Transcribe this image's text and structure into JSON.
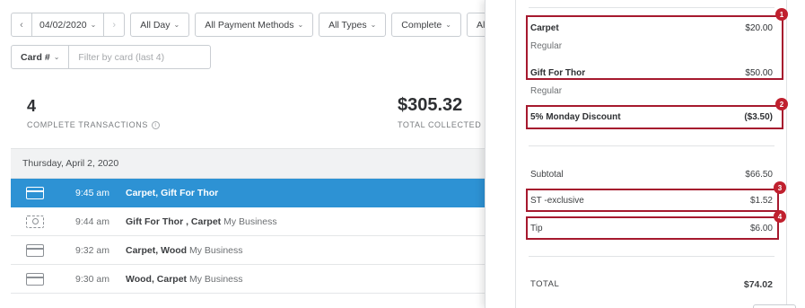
{
  "filters": {
    "prev_arrow": "‹",
    "date": "04/02/2020",
    "next_arrow": "›",
    "time_range": "All Day",
    "payment_methods": "All Payment Methods",
    "types": "All Types",
    "status": "Complete",
    "clipped_filter": "All",
    "chevron": "⌄"
  },
  "card_filter": {
    "label": "Card #",
    "placeholder": "Filter by card (last 4)"
  },
  "stats": {
    "transactions_count": "4",
    "transactions_label": "COMPLETE TRANSACTIONS",
    "info_glyph": "i",
    "total_amount": "$305.32",
    "total_label": "TOTAL COLLECTED"
  },
  "day_header": "Thursday, April 2, 2020",
  "transactions": [
    {
      "icon": "card-icon",
      "time": "9:45 am",
      "items": "Carpet, Gift For Thor",
      "business": "",
      "active": true
    },
    {
      "icon": "cash-icon",
      "time": "9:44 am",
      "items": "Gift For Thor , Carpet",
      "business": "My Business",
      "active": false
    },
    {
      "icon": "card-icon",
      "time": "9:32 am",
      "items": "Carpet, Wood",
      "business": "My Business",
      "active": false
    },
    {
      "icon": "card-icon",
      "time": "9:30 am",
      "items": "Wood, Carpet",
      "business": "My Business",
      "active": false
    }
  ],
  "receipt": {
    "items": [
      {
        "name": "Carpet",
        "price": "$20.00",
        "variant": "Regular"
      },
      {
        "name": "Gift For Thor",
        "price": "$50.00",
        "variant": "Regular"
      }
    ],
    "discount": {
      "name": "5% Monday Discount",
      "amount": "($3.50)"
    },
    "subtotal": {
      "label": "Subtotal",
      "amount": "$66.50"
    },
    "tax": {
      "label": "ST -exclusive",
      "amount": "$1.52"
    },
    "tip": {
      "label": "Tip",
      "amount": "$6.00"
    },
    "total": {
      "label": "TOTAL",
      "amount": "$74.02"
    }
  },
  "annotations": [
    "1",
    "2",
    "3",
    "4"
  ],
  "colors": {
    "accent_blue": "#2d92d4",
    "highlight_red": "#a6192e",
    "badge_red": "#c0202e"
  }
}
